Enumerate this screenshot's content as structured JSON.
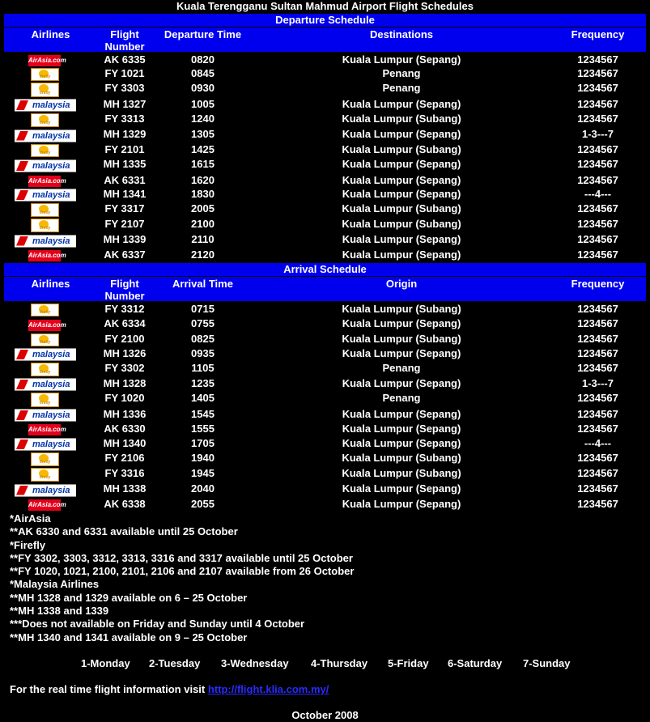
{
  "page_title": "Kuala Terengganu Sultan Mahmud Airport Flight Schedules",
  "departure": {
    "section_title": "Departure Schedule",
    "headers": {
      "airlines": "Airlines",
      "flight_number": "Flight Number",
      "time": "Departure Time",
      "place": "Destinations",
      "frequency": "Frequency"
    },
    "rows": [
      {
        "airline": "airasia",
        "flight": "AK 6335",
        "time": "0820",
        "place": "Kuala Lumpur (Sepang)",
        "freq": "1234567"
      },
      {
        "airline": "firefly",
        "flight": "FY 1021",
        "time": "0845",
        "place": "Penang",
        "freq": "1234567"
      },
      {
        "airline": "firefly",
        "flight": "FY 3303",
        "time": "0930",
        "place": "Penang",
        "freq": "1234567"
      },
      {
        "airline": "malaysia",
        "flight": "MH 1327",
        "time": "1005",
        "place": "Kuala Lumpur (Sepang)",
        "freq": "1234567"
      },
      {
        "airline": "firefly",
        "flight": "FY 3313",
        "time": "1240",
        "place": "Kuala Lumpur (Subang)",
        "freq": "1234567"
      },
      {
        "airline": "malaysia",
        "flight": "MH 1329",
        "time": "1305",
        "place": "Kuala Lumpur (Sepang)",
        "freq": "1-3---7"
      },
      {
        "airline": "firefly",
        "flight": "FY 2101",
        "time": "1425",
        "place": "Kuala Lumpur (Subang)",
        "freq": "1234567"
      },
      {
        "airline": "malaysia",
        "flight": "MH 1335",
        "time": "1615",
        "place": "Kuala Lumpur (Sepang)",
        "freq": "1234567"
      },
      {
        "airline": "airasia",
        "flight": "AK 6331",
        "time": "1620",
        "place": "Kuala Lumpur (Sepang)",
        "freq": "1234567"
      },
      {
        "airline": "malaysia",
        "flight": "MH 1341",
        "time": "1830",
        "place": "Kuala Lumpur (Sepang)",
        "freq": "---4---"
      },
      {
        "airline": "firefly",
        "flight": "FY 3317",
        "time": "2005",
        "place": "Kuala Lumpur (Subang)",
        "freq": "1234567"
      },
      {
        "airline": "firefly",
        "flight": "FY 2107",
        "time": "2100",
        "place": "Kuala Lumpur (Subang)",
        "freq": "1234567"
      },
      {
        "airline": "malaysia",
        "flight": "MH 1339",
        "time": "2110",
        "place": "Kuala Lumpur (Sepang)",
        "freq": "1234567"
      },
      {
        "airline": "airasia",
        "flight": "AK 6337",
        "time": "2120",
        "place": "Kuala Lumpur (Sepang)",
        "freq": "1234567"
      }
    ]
  },
  "arrival": {
    "section_title": "Arrival Schedule",
    "headers": {
      "airlines": "Airlines",
      "flight_number": "Flight Number",
      "time": "Arrival Time",
      "place": "Origin",
      "frequency": "Frequency"
    },
    "rows": [
      {
        "airline": "firefly",
        "flight": "FY 3312",
        "time": "0715",
        "place": "Kuala Lumpur (Subang)",
        "freq": "1234567"
      },
      {
        "airline": "airasia",
        "flight": "AK 6334",
        "time": "0755",
        "place": "Kuala Lumpur (Sepang)",
        "freq": "1234567"
      },
      {
        "airline": "firefly",
        "flight": "FY 2100",
        "time": "0825",
        "place": "Kuala Lumpur (Subang)",
        "freq": "1234567"
      },
      {
        "airline": "malaysia",
        "flight": "MH 1326",
        "time": "0935",
        "place": "Kuala Lumpur (Sepang)",
        "freq": "1234567"
      },
      {
        "airline": "firefly",
        "flight": "FY 3302",
        "time": "1105",
        "place": "Penang",
        "freq": "1234567"
      },
      {
        "airline": "malaysia",
        "flight": "MH 1328",
        "time": "1235",
        "place": "Kuala Lumpur (Sepang)",
        "freq": "1-3---7"
      },
      {
        "airline": "firefly",
        "flight": "FY 1020",
        "time": "1405",
        "place": "Penang",
        "freq": "1234567"
      },
      {
        "airline": "malaysia",
        "flight": "MH 1336",
        "time": "1545",
        "place": "Kuala Lumpur (Sepang)",
        "freq": "1234567"
      },
      {
        "airline": "airasia",
        "flight": "AK 6330",
        "time": "1555",
        "place": "Kuala Lumpur (Sepang)",
        "freq": "1234567"
      },
      {
        "airline": "malaysia",
        "flight": "MH 1340",
        "time": "1705",
        "place": "Kuala Lumpur (Sepang)",
        "freq": "---4---"
      },
      {
        "airline": "firefly",
        "flight": "FY 2106",
        "time": "1940",
        "place": "Kuala Lumpur (Subang)",
        "freq": "1234567"
      },
      {
        "airline": "firefly",
        "flight": "FY 3316",
        "time": "1945",
        "place": "Kuala Lumpur (Subang)",
        "freq": "1234567"
      },
      {
        "airline": "malaysia",
        "flight": "MH 1338",
        "time": "2040",
        "place": "Kuala Lumpur (Sepang)",
        "freq": "1234567"
      },
      {
        "airline": "airasia",
        "flight": "AK 6338",
        "time": "2055",
        "place": "Kuala Lumpur (Sepang)",
        "freq": "1234567"
      }
    ]
  },
  "logos": {
    "airasia": {
      "text": "AirAsia.com",
      "color": "#e3001b"
    },
    "firefly": {
      "text": "firefly",
      "color": "#f6b800"
    },
    "malaysia": {
      "text": "malaysia",
      "color": "#0033aa",
      "accent": "#dd0000"
    }
  },
  "notes": [
    "*AirAsia",
    "**AK 6330 and 6331 available until 25 October",
    "*Firefly",
    "**FY 3302, 3303, 3312, 3313, 3316 and 3317 available until 25 October",
    "**FY 1020, 1021, 2100, 2101, 2106 and 2107 available from 26 October",
    "*Malaysia Airlines",
    "**MH 1328 and 1329 available on 6 – 25 October",
    "**MH 1338 and 1339",
    "***Does not available on Friday and Sunday until 4 October",
    "**MH 1340 and 1341 available on 9 – 25 October"
  ],
  "days": [
    "1-Monday",
    "2-Tuesday",
    "3-Wednesday",
    "4-Thursday",
    "5-Friday",
    "6-Saturday",
    "7-Sunday"
  ],
  "realtime": {
    "text": "For the real time flight information visit",
    "link": "http://flight.klia.com.my/"
  },
  "date_line": "October 2008",
  "colors": {
    "background": "#000000",
    "header_bar": "#0000ee",
    "text": "#ffffff",
    "link": "#2a2aff"
  }
}
